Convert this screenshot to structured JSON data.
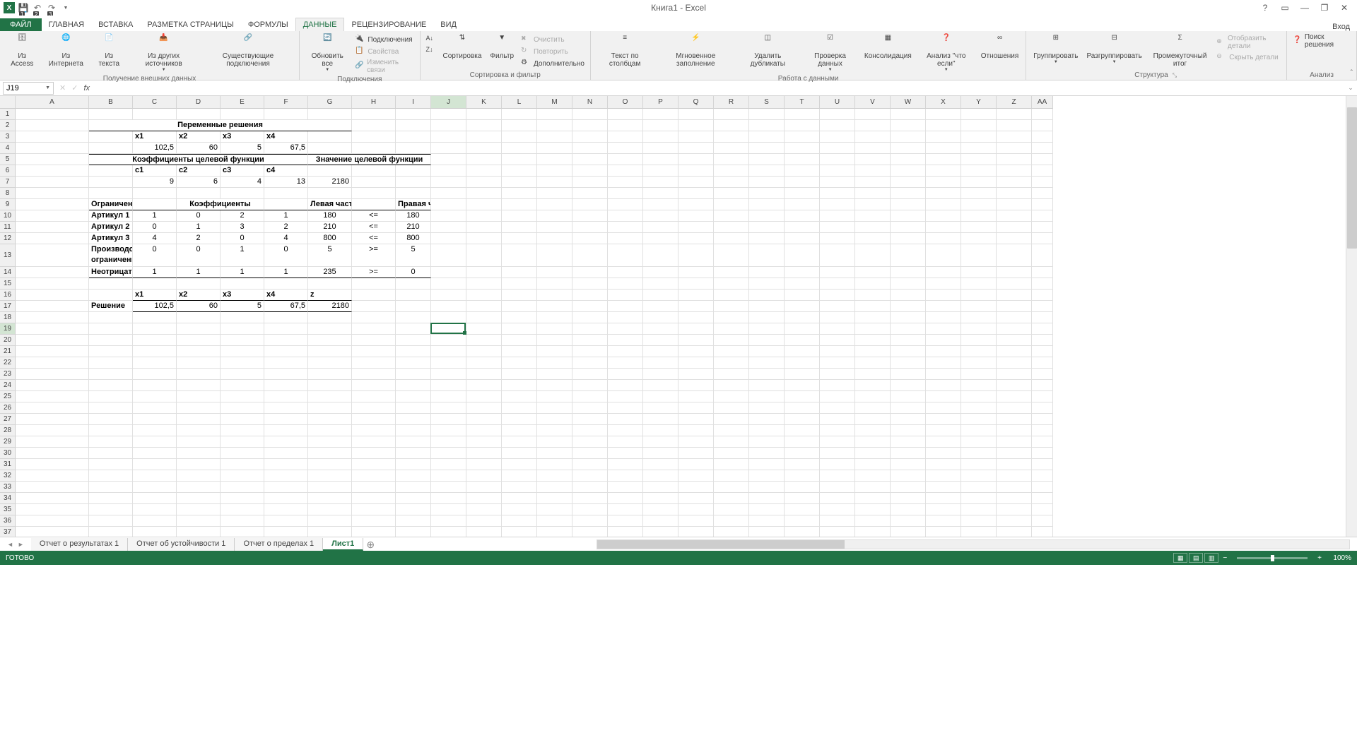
{
  "app": {
    "title": "Книга1 - Excel",
    "login": "Вход"
  },
  "qat_keys": [
    "1",
    "2",
    "3"
  ],
  "tabs": {
    "file": {
      "label": "ФАЙЛ",
      "key": "Ф"
    },
    "list": [
      {
        "label": "ГЛАВНАЯ",
        "key": "Я"
      },
      {
        "label": "ВСТАВКА",
        "key": "С"
      },
      {
        "label": "РАЗМЕТКА СТРАНИЦЫ",
        "key": "З"
      },
      {
        "label": "ФОРМУЛЫ",
        "key": "Л"
      },
      {
        "label": "ДАННЫЕ",
        "key": "Ё",
        "active": true
      },
      {
        "label": "РЕЦЕНЗИРОВАНИЕ",
        "key": "Р"
      },
      {
        "label": "ВИД",
        "key": "О"
      }
    ]
  },
  "ribbon": {
    "ext_data": {
      "label": "Получение внешних данных",
      "access": "Из Access",
      "web": "Из Интернета",
      "text": "Из текста",
      "other": "Из других источников",
      "exist": "Существующие подключения"
    },
    "conn": {
      "label": "Подключения",
      "refresh": "Обновить все",
      "conns": "Подключения",
      "props": "Свойства",
      "links": "Изменить связи"
    },
    "sort": {
      "label": "Сортировка и фильтр",
      "sort": "Сортировка",
      "filter": "Фильтр",
      "clear": "Очистить",
      "reapply": "Повторить",
      "adv": "Дополнительно"
    },
    "tools": {
      "label": "Работа с данными",
      "t2c": "Текст по столбцам",
      "flash": "Мгновенное заполнение",
      "dup": "Удалить дубликаты",
      "valid": "Проверка данных",
      "consol": "Консолидация",
      "whatif": "Анализ \"что если\"",
      "rel": "Отношения"
    },
    "outline": {
      "label": "Структура",
      "group": "Группировать",
      "ungroup": "Разгруппировать",
      "subtotal": "Промежуточный итог",
      "show": "Отобразить детали",
      "hide": "Скрыть детали"
    },
    "analysis": {
      "label": "Анализ",
      "solver": "Поиск решения"
    }
  },
  "namebox": "J19",
  "columns": [
    "A",
    "B",
    "C",
    "D",
    "E",
    "F",
    "G",
    "H",
    "I",
    "J",
    "K",
    "L",
    "M",
    "N",
    "O",
    "P",
    "Q",
    "R",
    "S",
    "T",
    "U",
    "V",
    "W",
    "X",
    "Y",
    "Z",
    "AA"
  ],
  "col_widths": {
    "A": 22,
    "B": 104,
    "default": 50,
    "narrow": 50
  },
  "rows_count": 38,
  "sheet": {
    "r2_title": "Переменные решения",
    "r3": {
      "c": "x1",
      "d": "x2",
      "e": "x3",
      "f": "x4"
    },
    "r4": {
      "c": "102,5",
      "d": "60",
      "e": "5",
      "f": "67,5"
    },
    "r5_left": "Коэффициенты целевой функции",
    "r5_right": "Значение целевой функции",
    "r6": {
      "c": "c1",
      "d": "c2",
      "e": "c3",
      "f": "c4"
    },
    "r7": {
      "c": "9",
      "d": "6",
      "e": "4",
      "f": "13",
      "g": "2180"
    },
    "r9": {
      "b": "Ограничения",
      "coef": "Коэффициенты",
      "g": "Левая часть",
      "i": "Правая часть"
    },
    "constraints": [
      {
        "b": "Артикул 1",
        "c": "1",
        "d": "0",
        "e": "2",
        "f": "1",
        "g": "180",
        "h": "<=",
        "i": "180"
      },
      {
        "b": "Артикул 2",
        "c": "0",
        "d": "1",
        "e": "3",
        "f": "2",
        "g": "210",
        "h": "<=",
        "i": "210"
      },
      {
        "b": "Артикул 3",
        "c": "4",
        "d": "2",
        "e": "0",
        "f": "4",
        "g": "800",
        "h": "<=",
        "i": "800"
      },
      {
        "b": "Производственное ограничение",
        "c": "0",
        "d": "0",
        "e": "1",
        "f": "0",
        "g": "5",
        "h": ">=",
        "i": "5"
      },
      {
        "b": "Неотрицательность",
        "c": "1",
        "d": "1",
        "e": "1",
        "f": "1",
        "g": "235",
        "h": ">=",
        "i": "0"
      }
    ],
    "r16": {
      "c": "x1",
      "d": "x2",
      "e": "x3",
      "f": "x4",
      "g": "z"
    },
    "r17": {
      "b": "Решение",
      "c": "102,5",
      "d": "60",
      "e": "5",
      "f": "67,5",
      "g": "2180"
    }
  },
  "sheets": [
    "Отчет о результатах 1",
    "Отчет об устойчивости 1",
    "Отчет о пределах 1",
    "Лист1"
  ],
  "active_sheet": 3,
  "status": {
    "ready": "ГОТОВО",
    "zoom": "100%"
  }
}
